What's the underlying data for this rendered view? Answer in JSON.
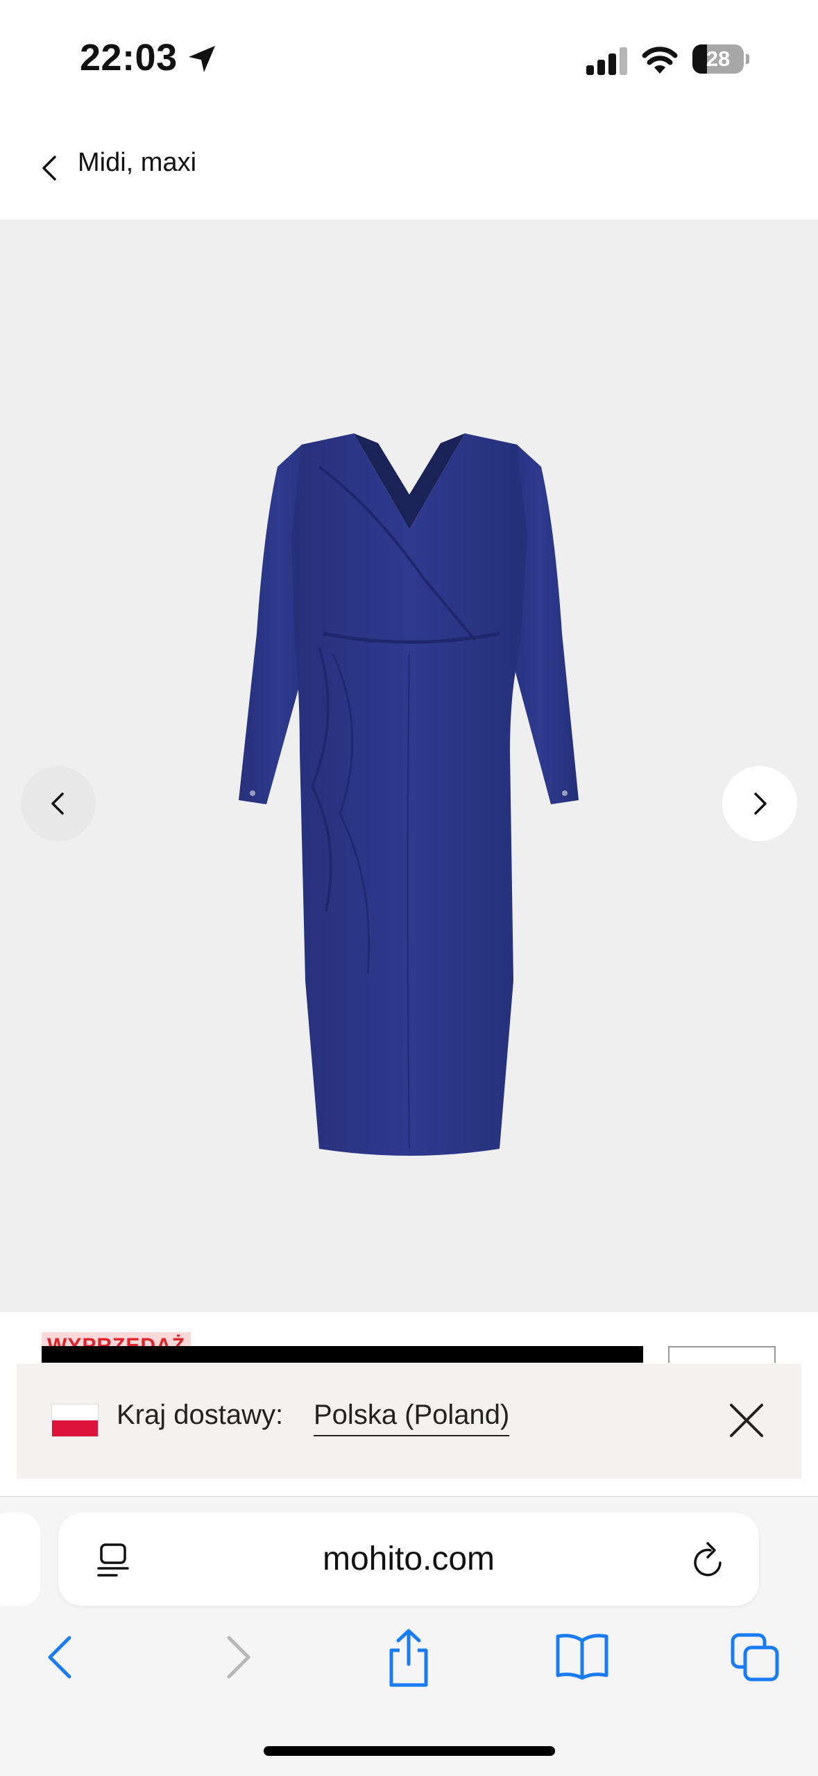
{
  "status_bar": {
    "time": "22:03",
    "battery_level": "28"
  },
  "header": {
    "back_label": "Midi, maxi"
  },
  "product_image": {
    "icons": [
      "chevron-left-icon",
      "chevron-right-icon"
    ],
    "dress_color": "#2a3585"
  },
  "sale_badge": "WYPRZEDAŻ",
  "country_banner": {
    "label": "Kraj dostawy:",
    "country": "Polska (Poland)"
  },
  "browser": {
    "url": "mohito.com",
    "accent_color": "#1a7cf4"
  }
}
